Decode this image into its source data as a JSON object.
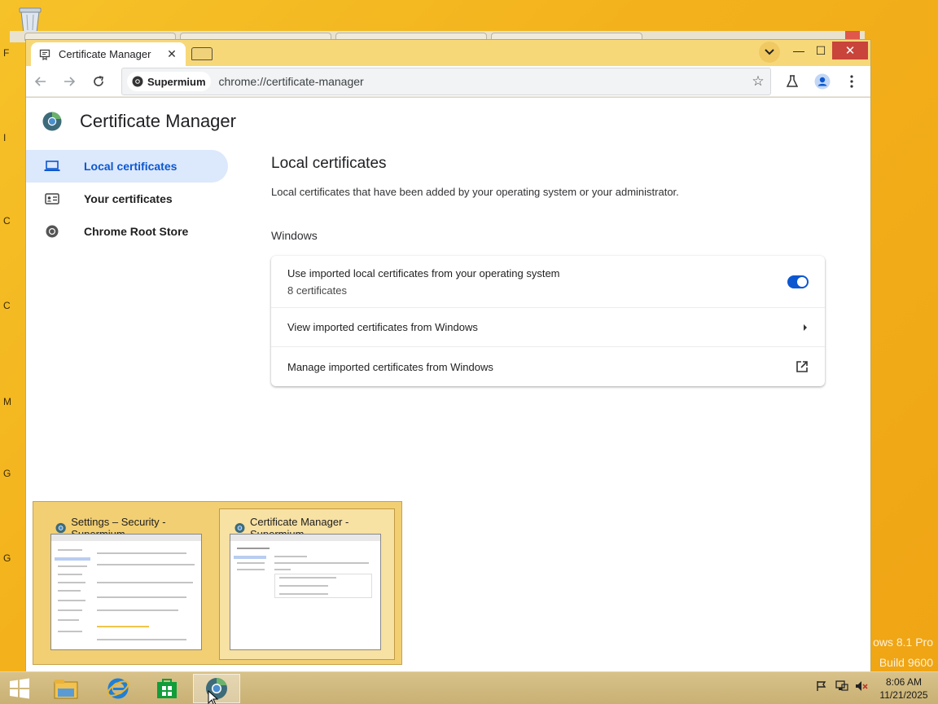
{
  "desktop": {
    "edge_letters": [
      "F",
      "I",
      "C",
      "C",
      "M",
      "G",
      "G"
    ],
    "watermark_line1": "ows 8.1 Pro",
    "watermark_line2": "Build 9600"
  },
  "browser": {
    "tab": {
      "title": "Certificate Manager",
      "close": "✕"
    },
    "window_buttons": {
      "minimize": "—",
      "maximize": "☐",
      "close": "✕"
    },
    "omnibox": {
      "chip_label": "Supermium",
      "url": "chrome://certificate-manager"
    }
  },
  "page": {
    "title": "Certificate Manager",
    "sidebar": {
      "items": [
        {
          "label": "Local certificates",
          "icon": "laptop-icon",
          "active": true
        },
        {
          "label": "Your certificates",
          "icon": "id-card-icon",
          "active": false
        },
        {
          "label": "Chrome Root Store",
          "icon": "chrome-icon",
          "active": false
        }
      ]
    },
    "main": {
      "heading": "Local certificates",
      "description": "Local certificates that have been added by your operating system or your administrator.",
      "section": "Windows",
      "rows": {
        "use_imported": {
          "label": "Use imported local certificates from your operating system",
          "sublabel": "8 certificates",
          "toggle_on": true
        },
        "view_imported": {
          "label": "View imported certificates from Windows"
        },
        "manage_imported": {
          "label": "Manage imported certificates from Windows"
        }
      }
    }
  },
  "thumbnails": [
    {
      "title": "Settings – Security - Supermium",
      "hover": false
    },
    {
      "title": "Certificate Manager - Supermium",
      "hover": true
    }
  ],
  "taskbar": {
    "time": "8:06 AM",
    "date": "11/21/2025"
  },
  "colors": {
    "accent": "#0b57d0",
    "active_bg": "#dce8fb",
    "desktop": "#f3b21c"
  }
}
